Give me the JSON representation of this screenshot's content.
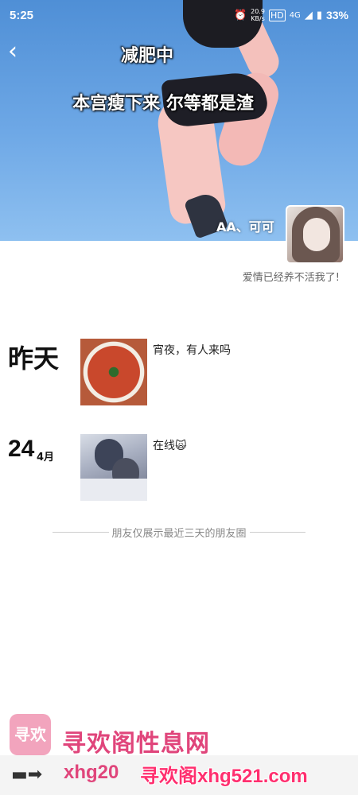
{
  "status_bar": {
    "time": "5:25",
    "alarm_icon": "alarm-clock-icon",
    "network_speed": "20.9",
    "network_speed_unit": "KB/s",
    "hd_icon": "hd-icon",
    "signal_label": "4G",
    "battery": "33%"
  },
  "cover": {
    "caption_line1": "减肥中",
    "caption_line2": "本宫瘦下来 尔等都是渣",
    "profile_name": "AA、可可",
    "signature": "爱情已经养不活我了!"
  },
  "moments": [
    {
      "date_label": "昨天",
      "text": "宵夜，有人来吗",
      "image": "crayfish-dish"
    },
    {
      "day": "24",
      "month": "4月",
      "text": "在线🙀",
      "image": "anime-couple"
    }
  ],
  "footer_note": "朋友仅展示最近三天的朋友圈",
  "watermark": {
    "logo": "寻欢",
    "title": "寻欢阁性息网",
    "url_partial": "xhg20",
    "url_overlay": "寻欢阁xhg521.com"
  }
}
